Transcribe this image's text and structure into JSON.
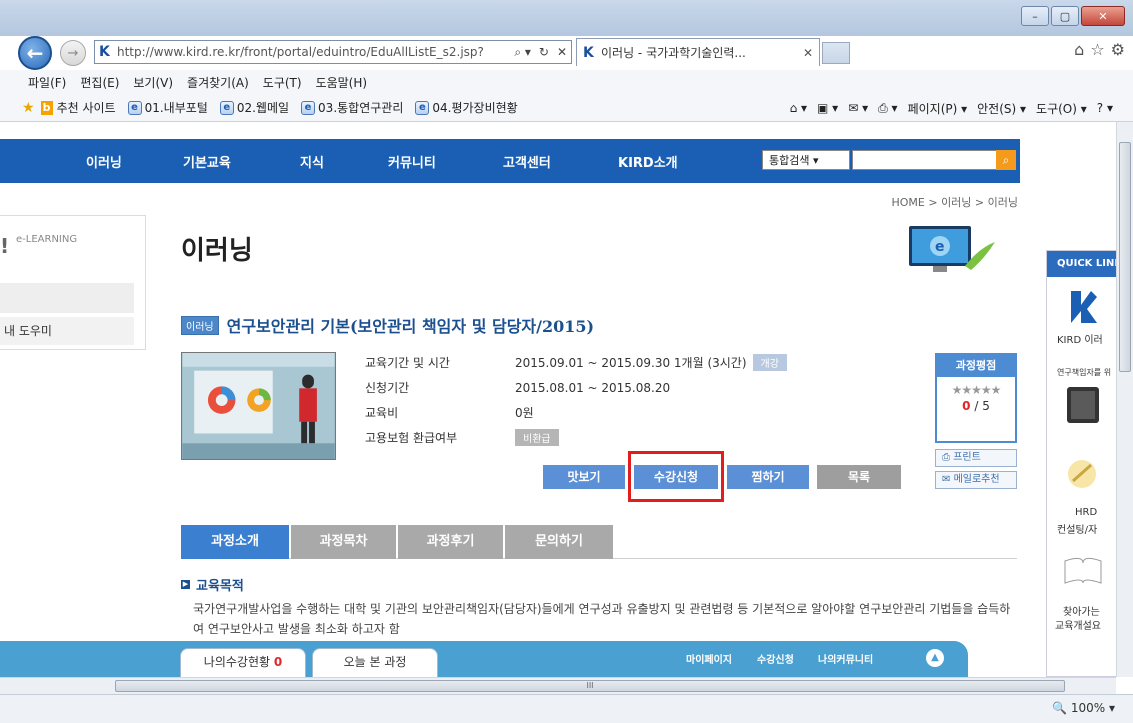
{
  "browser": {
    "address": "http://www.kird.re.kr/front/portal/eduintro/EduAllListE_s2.jsp?",
    "tab_title": "이러닝 - 국가과학기술인력...",
    "menu": [
      "파일(F)",
      "편집(E)",
      "보기(V)",
      "즐겨찾기(A)",
      "도구(T)",
      "도움말(H)"
    ],
    "favorites": [
      "추천 사이트",
      "01.내부포털",
      "02.웹메일",
      "03.통합연구관리",
      "04.평가장비현황"
    ],
    "command_bar": [
      "페이지(P) ▾",
      "안전(S) ▾",
      "도구(O) ▾"
    ],
    "zoom": "100%",
    "scroll_marker": "III"
  },
  "site": {
    "nav": [
      "이러닝",
      "기본교육",
      "지식",
      "커뮤니티",
      "고객센터",
      "KIRD소개"
    ],
    "search_select": "통합검색",
    "location": "HOME > 이러닝 > 이러닝",
    "lnb_label": "e-LEARNING",
    "lnb_item": "내 도우미"
  },
  "page": {
    "title": "이러닝",
    "badge": "이러닝",
    "course_name": "연구보안관리 기본(보안관리 책임자 및 담당자/2015)",
    "info": [
      {
        "label": "교육기간 및 시간",
        "value": "2015.09.01 ~ 2015.09.30  1개월 (3시간)",
        "tag": "개강"
      },
      {
        "label": "신청기간",
        "value": "2015.08.01 ~ 2015.08.20",
        "tag": ""
      },
      {
        "label": "교육비",
        "value": "0원",
        "tag": ""
      },
      {
        "label": "고용보험 환급여부",
        "value": "",
        "tag": "비환급"
      }
    ],
    "rating_title": "과정평점",
    "rating_stars": "★★★★★",
    "rating_score": "0",
    "rating_max": "/ 5",
    "print_label": "프린트",
    "mail_label": "메일로추천",
    "buttons": {
      "preview": "맛보기",
      "apply": "수강신청",
      "wish": "찜하기",
      "list": "목록"
    },
    "tabs": [
      "과정소개",
      "과정목차",
      "과정후기",
      "문의하기"
    ],
    "section_title": "교육목적",
    "section_text": "국가연구개발사업을 수행하는 대학 및 기관의 보안관리책임자(담당자)들에게 연구성과 유출방지 및 관련법령 등 기본적으로 알아야할 연구보안관리 기법들을 습득하여 연구보안사고 발생을 최소화 하고자 함"
  },
  "bottom": {
    "my_status": "나의수강현황",
    "my_count": "0",
    "today": "오늘 본 과정",
    "links": [
      "마이페이지",
      "수강신청",
      "나의커뮤니티"
    ]
  },
  "quick": {
    "title": "QUICK LINK",
    "items": [
      "KIRD 이러",
      "연구책임자를 위",
      "HRD",
      "컨설팅/자",
      "찾아가는",
      "교육개설요"
    ]
  }
}
